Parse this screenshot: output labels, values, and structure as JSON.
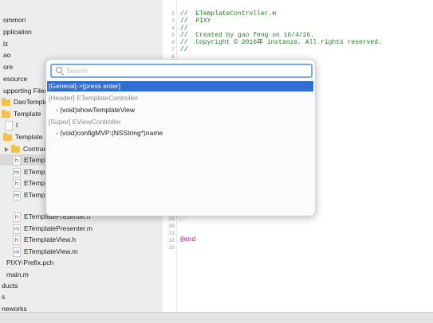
{
  "sidebar": {
    "items": [
      {
        "label": "ommon",
        "icon": "none"
      },
      {
        "label": "pplication",
        "icon": "none"
      },
      {
        "label": "lz",
        "icon": "none"
      },
      {
        "label": "ao",
        "icon": "none"
      },
      {
        "label": "ore",
        "icon": "none"
      },
      {
        "label": "esource",
        "icon": "none"
      },
      {
        "label": "upporting Files",
        "icon": "none"
      },
      {
        "label": "DaoTemplate",
        "icon": "folder"
      },
      {
        "label": "Template",
        "icon": "folder"
      },
      {
        "label": "t",
        "icon": "file"
      },
      {
        "label": "Template",
        "icon": "folder"
      },
      {
        "label": "Contract",
        "icon": "folder"
      },
      {
        "label": "ETemplateController.h",
        "icon": "h"
      },
      {
        "label": "ETemplateController.m",
        "icon": "m"
      },
      {
        "label": "ETemplateModel.h",
        "icon": "h"
      },
      {
        "label": "ETemplateModel.m",
        "icon": "m"
      },
      {
        "label": "ETemplatePresenter.h",
        "icon": "h"
      },
      {
        "label": "ETemplatePresenter.m",
        "icon": "m"
      },
      {
        "label": "ETemplateView.h",
        "icon": "h"
      },
      {
        "label": "ETemplateView.m",
        "icon": "m"
      },
      {
        "label": "PIXY-Prefix.pch",
        "icon": "h"
      },
      {
        "label": "main.m",
        "icon": "m"
      },
      {
        "label": "ducts",
        "icon": "none"
      },
      {
        "label": "s",
        "icon": "none"
      },
      {
        "label": "neworks",
        "icon": "none"
      }
    ]
  },
  "editor": {
    "lines_top": [
      {
        "num": "2",
        "text": "//  ETemplateController.m"
      },
      {
        "num": "3",
        "text": "//  PIXY"
      },
      {
        "num": "4",
        "text": "//"
      },
      {
        "num": "5",
        "text": "//  Created by gao feng on 16/4/26."
      },
      {
        "num": "6",
        "text": "//  Copyright © 2016年 instanza. All rights reserved."
      },
      {
        "num": "7",
        "text": "//"
      },
      {
        "num": "8",
        "text": ""
      }
    ],
    "lines_bottom": [
      {
        "num": "29",
        "text": ""
      },
      {
        "num": "30",
        "text": ""
      },
      {
        "num": "31",
        "text": ""
      },
      {
        "num": "32",
        "text": "@end"
      },
      {
        "num": "33",
        "text": ""
      }
    ]
  },
  "popover": {
    "search_placeholder": "Search",
    "rows": [
      {
        "text": "[General]->[press enter]",
        "kind": "selected"
      },
      {
        "text": "[Header] ETemplateController",
        "kind": "group"
      },
      {
        "text": "- (void)showTemplateView",
        "kind": "method"
      },
      {
        "text": "[Super] EViewController",
        "kind": "group"
      },
      {
        "text": "- (void)configMVP:(NSString*)name",
        "kind": "method"
      }
    ]
  },
  "colors": {
    "selection": "#2f6fd5",
    "comment": "#1e7d1e",
    "keyword": "#b5168b",
    "search_border": "#7aa7e3"
  }
}
